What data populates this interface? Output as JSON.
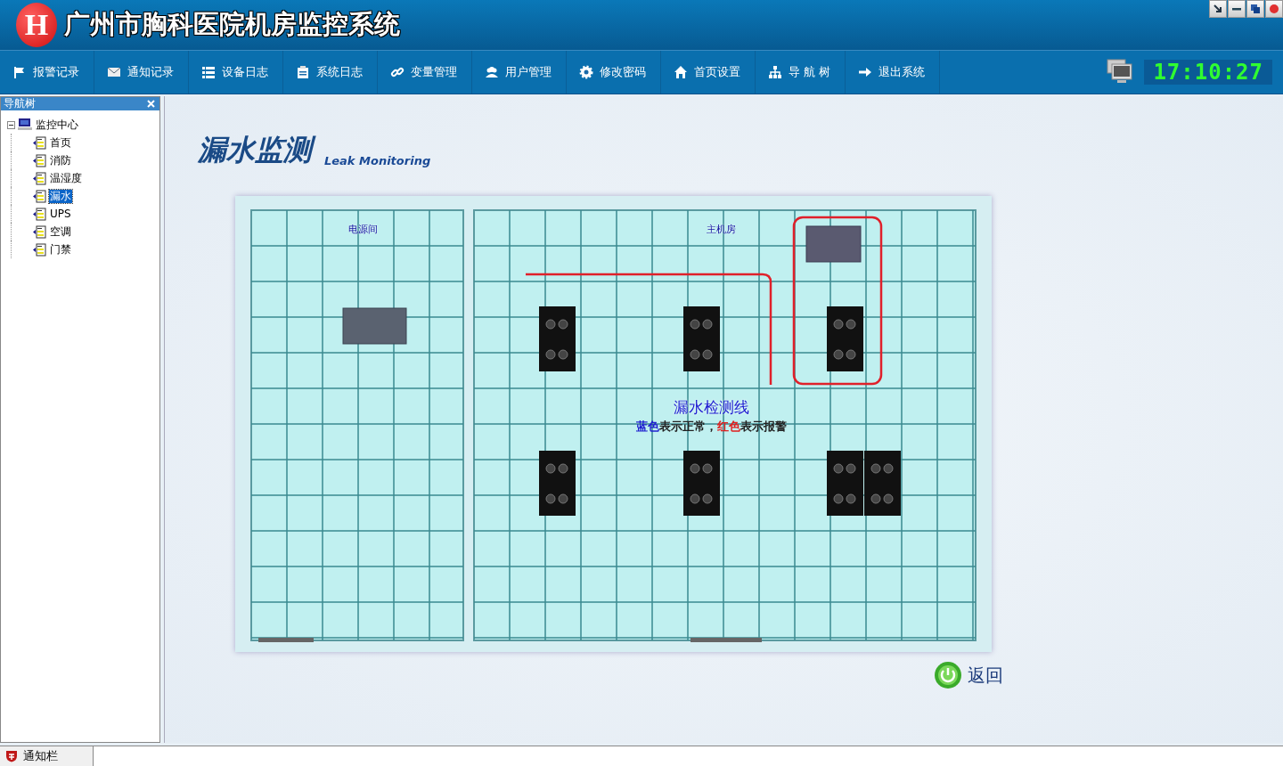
{
  "window": {
    "title": "广州市胸科医院机房监控系统",
    "logo_letter": "H"
  },
  "nav": [
    {
      "label": "报警记录",
      "kind": "flag"
    },
    {
      "label": "通知记录",
      "kind": "mail"
    },
    {
      "label": "设备日志",
      "kind": "list"
    },
    {
      "label": "系统日志",
      "kind": "clipboard"
    },
    {
      "label": "变量管理",
      "kind": "link"
    },
    {
      "label": "用户管理",
      "kind": "users"
    },
    {
      "label": "修改密码",
      "kind": "gear"
    },
    {
      "label": "首页设置",
      "kind": "home"
    },
    {
      "label": "导 航 树",
      "kind": "tree"
    },
    {
      "label": "退出系统",
      "kind": "arrow"
    }
  ],
  "clock": "17:10:27",
  "sidebar": {
    "title": "导航树",
    "tree": [
      {
        "label": "监控中心",
        "expanded": true,
        "selected": false,
        "children": [
          {
            "label": "首页",
            "selected": false
          },
          {
            "label": "消防",
            "selected": false
          },
          {
            "label": "温湿度",
            "selected": false
          },
          {
            "label": "漏水",
            "selected": true
          },
          {
            "label": "UPS",
            "selected": false
          },
          {
            "label": "空调",
            "selected": false
          },
          {
            "label": "门禁",
            "selected": false
          }
        ]
      }
    ]
  },
  "page": {
    "title": "漏水监测",
    "subtitle": "Leak Monitoring"
  },
  "floor_plan": {
    "rooms": [
      "电源间",
      "主机房"
    ],
    "leak_lines": [
      {
        "alarm": true
      },
      {
        "alarm": true
      }
    ],
    "legend_title": "漏水检测线",
    "legend": [
      {
        "text": "蓝色",
        "color": "#1f1fd0"
      },
      {
        "text": "表示正常，",
        "color": "#222222"
      },
      {
        "text": "红色",
        "color": "#e02020"
      },
      {
        "text": "表示报警",
        "color": "#222222"
      }
    ]
  },
  "back_button": "返回",
  "status_bar": {
    "tab": "通知栏"
  }
}
